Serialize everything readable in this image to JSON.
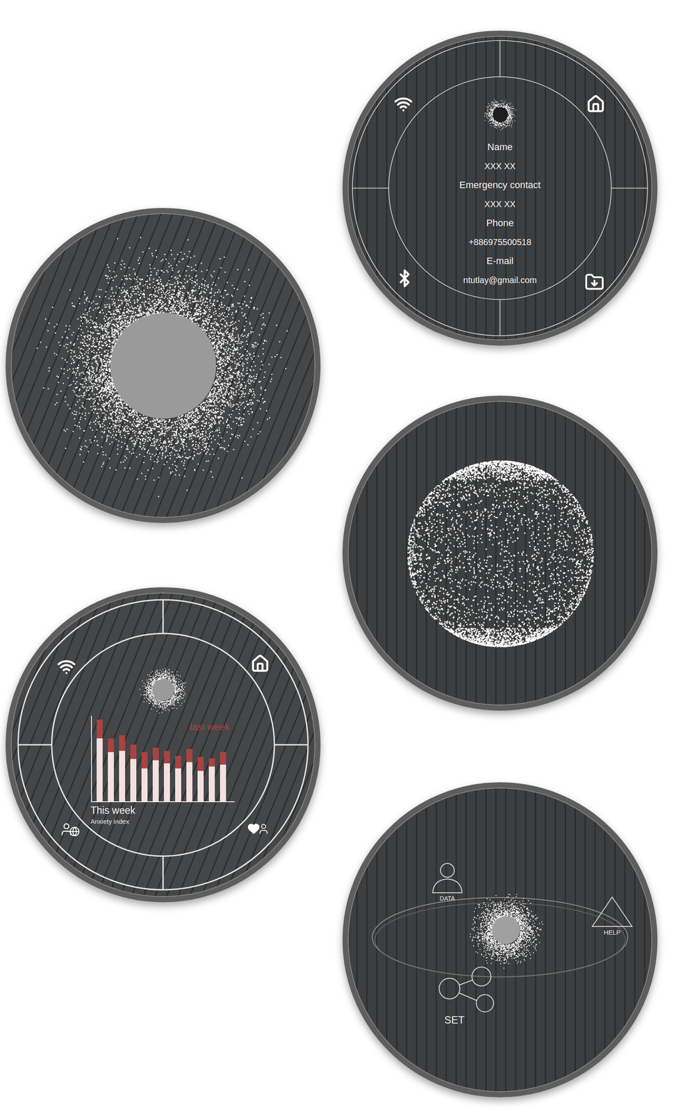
{
  "screens": [
    {
      "kind": "profile",
      "fields": [
        {
          "label": "Name",
          "value": "XXX XX"
        },
        {
          "label": "Emergency contact",
          "value": "XXX XX"
        },
        {
          "label": "Phone",
          "value": "+886975500518"
        },
        {
          "label": "E-mail",
          "value": "ntutlay@gmail.com"
        }
      ]
    },
    {
      "kind": "ring"
    },
    {
      "kind": "sphere"
    },
    {
      "kind": "chart",
      "title": "This week",
      "subtitle": "Anxiety index",
      "series": [
        {
          "name": "This week",
          "color": "#f3e1e1",
          "values": [
            102,
            80,
            82,
            69,
            54,
            67,
            62,
            54,
            64,
            50,
            57,
            60
          ]
        },
        {
          "name": "last week",
          "color": "#a84343",
          "values": [
            132,
            102,
            107,
            92,
            80,
            87,
            82,
            74,
            85,
            72,
            70,
            80
          ]
        }
      ]
    },
    {
      "kind": "menu",
      "items": [
        {
          "label": "DATA"
        },
        {
          "label": "HELP"
        },
        {
          "label": "SET"
        }
      ]
    }
  ]
}
